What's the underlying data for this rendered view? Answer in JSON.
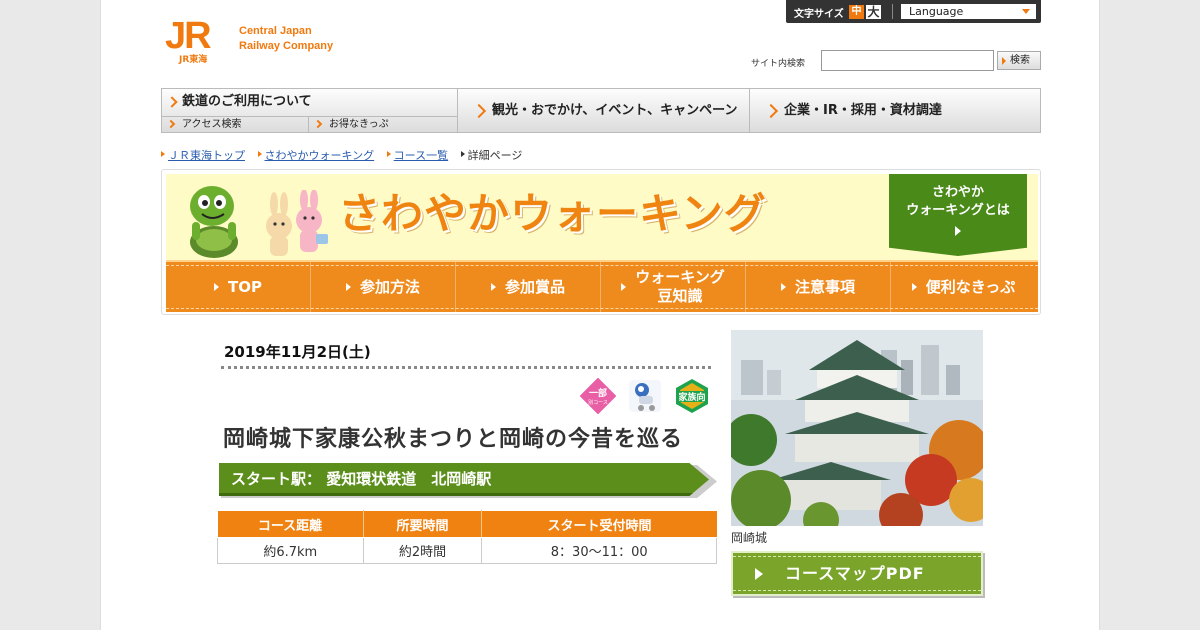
{
  "header": {
    "logo_mark": "JR",
    "logo_sub": "JR東海",
    "company_line1": "Central Japan",
    "company_line2": "Railway Company",
    "font_size_label": "文字サイズ",
    "font_size_mid": "中",
    "font_size_large": "大",
    "language_label": "Language",
    "search_label": "サイト内検索",
    "search_value": "",
    "search_button": "検索"
  },
  "gnav": {
    "rail": "鉄道のご利用について",
    "access": "アクセス検索",
    "tickets": "お得なきっぷ",
    "tour": "観光・おでかけ、イベント、キャンペーン",
    "corp": "企業・IR・採用・資材調達"
  },
  "breadcrumb": [
    "ＪＲ東海トップ",
    "さわやかウォーキング",
    "コース一覧",
    "詳細ページ"
  ],
  "banner": {
    "title": "さわやかウォーキング",
    "about_line1": "さわやか",
    "about_line2": "ウォーキングとは"
  },
  "tabs": [
    {
      "label": "TOP",
      "label2": ""
    },
    {
      "label": "参加方法",
      "label2": ""
    },
    {
      "label": "参加賞品",
      "label2": ""
    },
    {
      "label": "ウォーキング",
      "label2": "豆知識"
    },
    {
      "label": "注意事項",
      "label2": ""
    },
    {
      "label": "便利なきっぷ",
      "label2": ""
    }
  ],
  "event": {
    "date": "2019年11月2日(土)",
    "badges": {
      "partial_course_top": "一部",
      "partial_course_bottom": "別コース",
      "family": "家族向"
    },
    "title": "岡崎城下家康公秋まつりと岡崎の今昔を巡る",
    "start_station": "スタート駅：  愛知環状鉄道　北岡崎駅",
    "table": {
      "headers": [
        "コース距離",
        "所要時間",
        "スタート受付時間"
      ],
      "values": [
        "約6.7km",
        "約2時間",
        "8：30～11：00"
      ]
    },
    "photo_caption": "岡崎城",
    "pdf_button": "コースマップPDF"
  },
  "colors": {
    "brand_orange": "#ef8210",
    "green": "#5c8e1c",
    "banner_yellow": "#fffbc6"
  }
}
